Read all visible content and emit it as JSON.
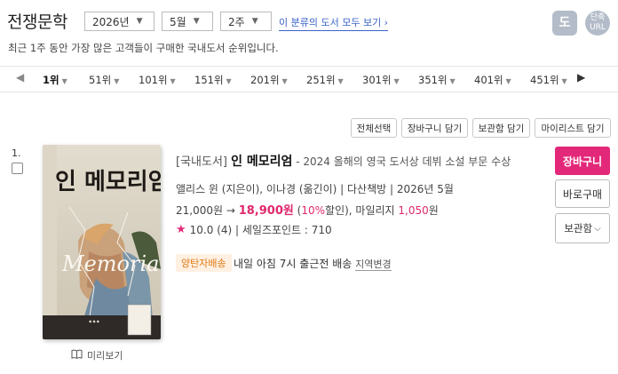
{
  "header": {
    "title": "전쟁문학",
    "year_select": "2026년",
    "month_select": "5월",
    "week_select": "2주",
    "category_link": "이 분류의 도서 모두 보기 ›",
    "icon_book": "도",
    "icon_shorturl_line1": "단축",
    "icon_shorturl_line2": "URL"
  },
  "subtitle": "최근 1주 동안 가장 많은 고객들이 구매한 국내도서 순위입니다.",
  "pagination": {
    "prev": "◀",
    "next": "▶",
    "items": [
      "1위",
      "51위",
      "101위",
      "151위",
      "201위",
      "251위",
      "301위",
      "351위",
      "401위",
      "451위"
    ]
  },
  "toolbar": {
    "select_all": "전체선택",
    "add_cart": "장바구니 담기",
    "add_keep": "보관함 담기",
    "add_mylist": "마이리스트 담기"
  },
  "item": {
    "rank": "1.",
    "category_tag": "[국내도서]",
    "title": "인 메모리엄",
    "subtitle": " - 2024 올해의 영국 도서상 데뷔 소설 부문 수상",
    "meta": "앨리스 윈 (지은이), 이나경 (옮긴이) | 다산책방 | 2026년 5월",
    "price_list": "21,000원 → ",
    "price_sale": "18,900원",
    "price_pct_open": " (",
    "discount": "10%",
    "price_pct_close": "할인), 마일리지 ",
    "mileage": "1,050",
    "mileage_unit": "원",
    "rating": "10.0 (4) | 세일즈포인트 : 710",
    "badge": "양탄자배송",
    "ship_text": "내일 아침 7시 출근전 배송 ",
    "ship_change": "지역변경",
    "preview": "미리보기",
    "cover_title": "인 메모리엄",
    "cover_script": "Memoriam",
    "btn_cart": "장바구니",
    "btn_buy": "바로구매",
    "btn_keep": "보관함"
  },
  "colors": {
    "accent": "#e3287a",
    "link": "#3a62c8",
    "badge_bg": "#fff0e2",
    "badge_text": "#e07a15"
  }
}
